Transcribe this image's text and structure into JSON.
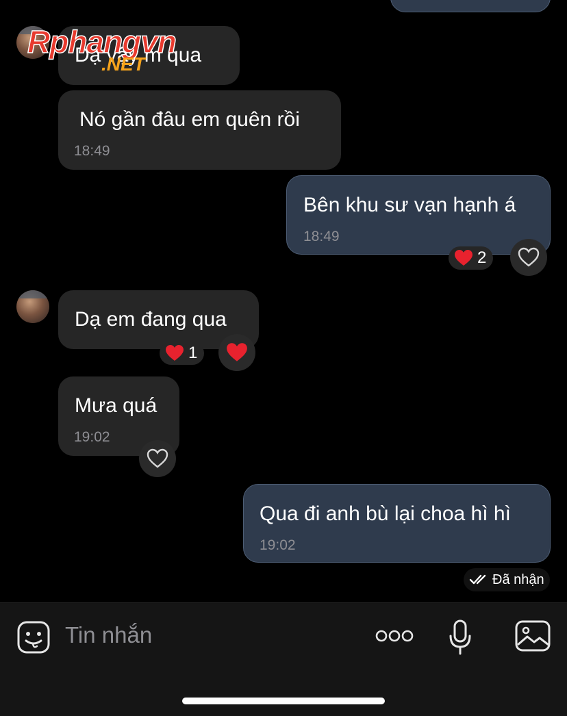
{
  "watermark": {
    "main": "Rphangvn",
    "suffix": ".NET"
  },
  "messages": [
    {
      "text": "Dạ vậy m qua"
    },
    {
      "text": "Nó gần đâu em quên rồi",
      "time": "18:49"
    },
    {
      "text": "Bên khu sư vạn hạnh á",
      "time": "18:49",
      "reaction": {
        "emoji": "heart",
        "count": "2"
      }
    },
    {
      "text": "Dạ em đang qua",
      "reaction": {
        "emoji": "heart",
        "count": "1"
      }
    },
    {
      "text": "Mưa quá",
      "time": "19:02"
    },
    {
      "text": "Qua đi anh bù lại choa hì hì",
      "time": "19:02"
    }
  ],
  "status": {
    "label": "Đã nhận"
  },
  "composer": {
    "placeholder": "Tin nhắn"
  },
  "colors": {
    "incoming": "#262626",
    "outgoing": "#2f3b4d",
    "heart": "#e8222e"
  },
  "icons": [
    "sticker-icon",
    "more-options-icon",
    "microphone-icon",
    "image-icon",
    "heart-outline-icon",
    "double-check-icon"
  ]
}
